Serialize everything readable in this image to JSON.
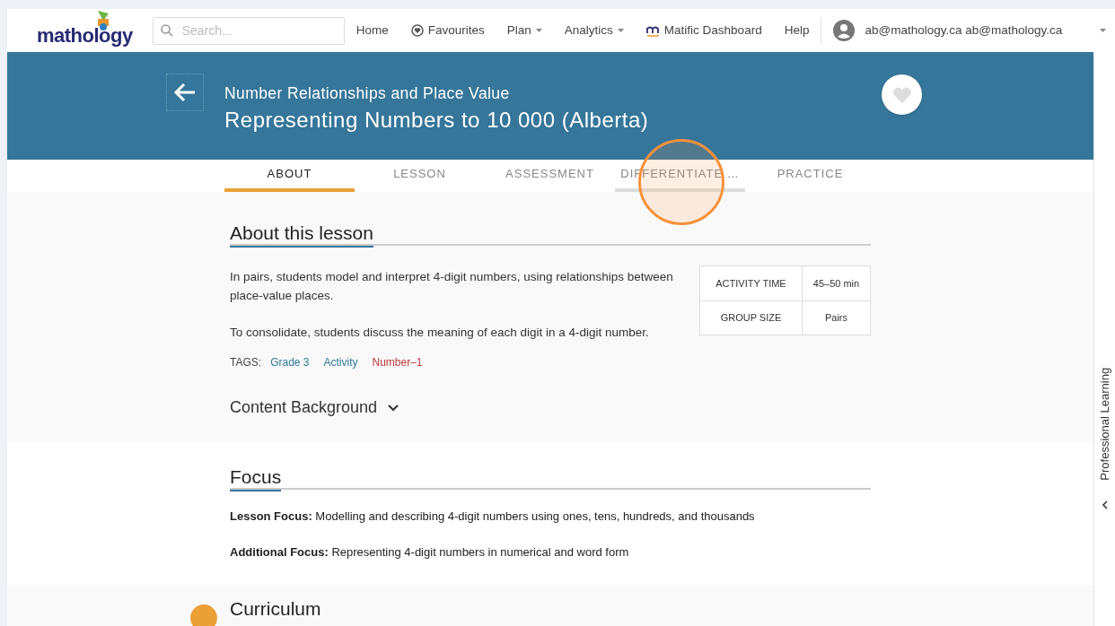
{
  "nav": {
    "logo": "mathology",
    "search": {
      "placeholder": "Search..."
    },
    "links": [
      {
        "label": "Home",
        "kind": "plain"
      },
      {
        "label": "Favourites",
        "kind": "heart"
      },
      {
        "label": "Plan",
        "kind": "dropdown"
      },
      {
        "label": "Analytics",
        "kind": "dropdown"
      },
      {
        "label": "Matific Dashboard",
        "kind": "matific"
      },
      {
        "label": "Help",
        "kind": "plain"
      }
    ],
    "user": "ab@mathology.ca ab@mathology.ca"
  },
  "header": {
    "subtitle": "Number Relationships and Place Value",
    "title": "Representing Numbers to 10 000 (Alberta)"
  },
  "tabs": [
    {
      "label": "ABOUT",
      "selected": true
    },
    {
      "label": "LESSON",
      "selected": false
    },
    {
      "label": "ASSESSMENT",
      "selected": false
    },
    {
      "label": "DIFFERENTIATE …",
      "selected": false
    },
    {
      "label": "PRACTICE",
      "selected": false
    }
  ],
  "about": {
    "heading": "About this lesson",
    "paragraphs": [
      "In pairs, students model and interpret 4-digit numbers, using relationships between place-value places.",
      "To consolidate, students discuss the meaning of each digit in a 4-digit number."
    ],
    "facts": [
      {
        "label": "ACTIVITY TIME",
        "value": "45–50 min"
      },
      {
        "label": "GROUP SIZE",
        "value": "Pairs"
      }
    ],
    "tags_label": "TAGS:",
    "tags": [
      {
        "label": "Grade 3",
        "color": "#2f7896"
      },
      {
        "label": "Activity",
        "color": "#2f7896"
      },
      {
        "label": "Number–1",
        "color": "#c0393b"
      }
    ],
    "content_background": {
      "label": "Content Background",
      "expanded": false
    }
  },
  "focus": {
    "heading": "Focus",
    "items": [
      "**Lesson Focus:** Modelling and describing 4-digit numbers using ones, tens, hundreds, and thousands",
      "**Additional Focus:** Representing 4-digit numbers in numerical and word form"
    ]
  },
  "curriculum": {
    "heading": "Curriculum"
  },
  "side_panel": {
    "label": "Professional Learning"
  }
}
